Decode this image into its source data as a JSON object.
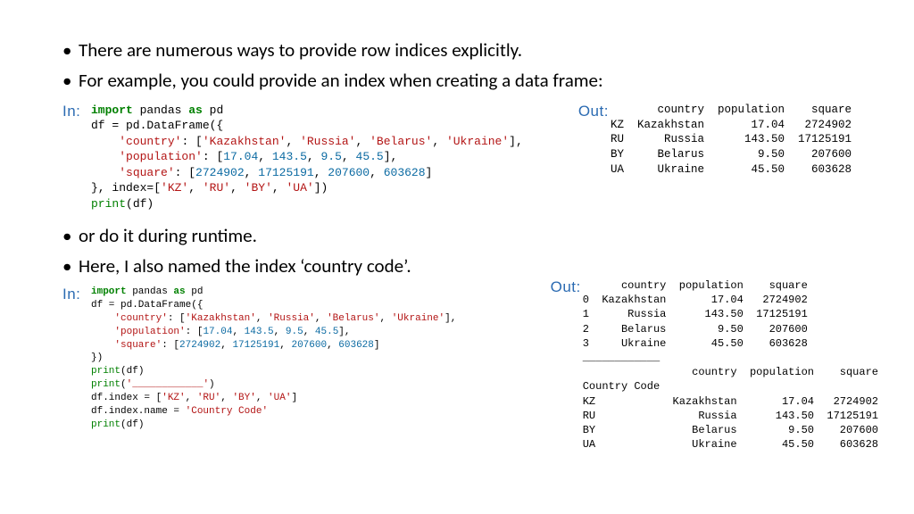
{
  "bullets": {
    "b1": "There are numerous ways to provide row indices explicitly.",
    "b2": "For example, you could provide an index when creating a data frame:",
    "b3": "or do it during runtime.",
    "b4": "Here, I also named the index ‘country code’."
  },
  "labels": {
    "in": "In:",
    "out": "Out:"
  },
  "code1": {
    "l1a": "import",
    "l1b": " pandas ",
    "l1c": "as",
    "l1d": " pd",
    "l2": "df = pd.DataFrame({",
    "l3a": "    ",
    "l3s": "'country'",
    "l3b": ": [",
    "l3c": "'Kazakhstan'",
    "l3d": ", ",
    "l3e": "'Russia'",
    "l3f": ", ",
    "l3g": "'Belarus'",
    "l3h": ", ",
    "l3i": "'Ukraine'",
    "l3j": "],",
    "l4a": "    ",
    "l4s": "'population'",
    "l4b": ": [",
    "l4c": "17.04",
    "l4d": ", ",
    "l4e": "143.5",
    "l4f": ", ",
    "l4g": "9.5",
    "l4h": ", ",
    "l4i": "45.5",
    "l4j": "],",
    "l5a": "    ",
    "l5s": "'square'",
    "l5b": ": [",
    "l5c": "2724902",
    "l5d": ", ",
    "l5e": "17125191",
    "l5f": ", ",
    "l5g": "207600",
    "l5h": ", ",
    "l5i": "603628",
    "l5j": "]",
    "l6a": "}, index=[",
    "l6b": "'KZ'",
    "l6c": ", ",
    "l6d": "'RU'",
    "l6e": ", ",
    "l6f": "'BY'",
    "l6g": ", ",
    "l6h": "'UA'",
    "l6i": "])",
    "l7a": "print",
    "l7b": "(df)"
  },
  "out1": "       country  population    square\nKZ  Kazakhstan       17.04   2724902\nRU      Russia      143.50  17125191\nBY     Belarus        9.50    207600\nUA     Ukraine       45.50    603628",
  "code2": {
    "l1a": "import",
    "l1b": " pandas ",
    "l1c": "as",
    "l1d": " pd",
    "l2": "df = pd.DataFrame({",
    "l3a": "    ",
    "l3s": "'country'",
    "l3b": ": [",
    "l3c": "'Kazakhstan'",
    "l3d": ", ",
    "l3e": "'Russia'",
    "l3f": ", ",
    "l3g": "'Belarus'",
    "l3h": ", ",
    "l3i": "'Ukraine'",
    "l3j": "],",
    "l4a": "    ",
    "l4s": "'population'",
    "l4b": ": [",
    "l4c": "17.04",
    "l4d": ", ",
    "l4e": "143.5",
    "l4f": ", ",
    "l4g": "9.5",
    "l4h": ", ",
    "l4i": "45.5",
    "l4j": "],",
    "l5a": "    ",
    "l5s": "'square'",
    "l5b": ": [",
    "l5c": "2724902",
    "l5d": ", ",
    "l5e": "17125191",
    "l5f": ", ",
    "l5g": "207600",
    "l5h": ", ",
    "l5i": "603628",
    "l5j": "]",
    "l6": "})",
    "l7a": "print",
    "l7b": "(df)",
    "l8a": "print",
    "l8b": "(",
    "l8c": "'____________'",
    "l8d": ")",
    "l9a": "df.index = [",
    "l9b": "'KZ'",
    "l9c": ", ",
    "l9d": "'RU'",
    "l9e": ", ",
    "l9f": "'BY'",
    "l9g": ", ",
    "l9h": "'UA'",
    "l9i": "]",
    "l10a": "df.index.name = ",
    "l10b": "'Country Code'",
    "l11a": "print",
    "l11b": "(df)"
  },
  "out2": "      country  population    square\n0  Kazakhstan       17.04   2724902\n1      Russia      143.50  17125191\n2     Belarus        9.50    207600\n3     Ukraine       45.50    603628\n____________\n                 country  population    square\nCountry Code                                  \nKZ            Kazakhstan       17.04   2724902\nRU                Russia      143.50  17125191\nBY               Belarus        9.50    207600\nUA               Ukraine       45.50    603628"
}
